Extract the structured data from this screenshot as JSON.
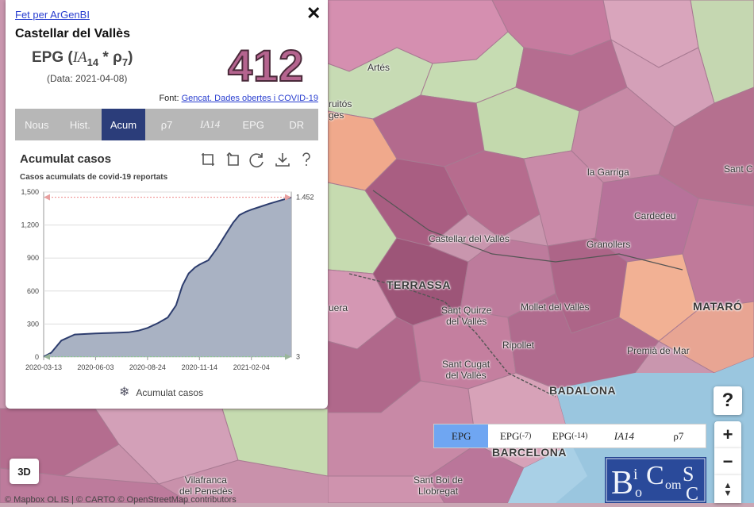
{
  "panel": {
    "link": "Fet per ArGenBI",
    "municipality": "Castellar del Vallès",
    "metric": {
      "prefix": "EPG (",
      "ia": "IA",
      "ia_sub": "14",
      "star": " * ",
      "rho": "ρ",
      "rho_sub": "7",
      "suffix": ")"
    },
    "date": "(Data: 2021-04-08)",
    "value": "412",
    "source_prefix": "Font: ",
    "source_link": "Gencat. Dades obertes i COVID-19",
    "tabs": [
      {
        "label": "Nous",
        "active": false
      },
      {
        "label": "Hist.",
        "active": false
      },
      {
        "label": "Acum",
        "active": true
      },
      {
        "label": "ρ7",
        "active": false
      },
      {
        "label": "IA14",
        "active": false
      },
      {
        "label": "EPG",
        "active": false
      },
      {
        "label": "DR",
        "active": false
      }
    ],
    "chart_title": "Acumulat casos",
    "chart_subtitle": "Casos acumulats de covid-19 reportats",
    "legend_label": "Acumulat casos",
    "icons": [
      "zoom-select-icon",
      "zoom-reset-icon",
      "restore-icon",
      "download-icon",
      "help-icon"
    ]
  },
  "chart_data": {
    "type": "area",
    "title": "Acumulat casos",
    "subtitle": "Casos acumulats de covid-19 reportats",
    "x_ticks": [
      "2020-03-13",
      "2020-06-03",
      "2020-08-24",
      "2020-11-14",
      "2021-02-04"
    ],
    "y_ticks": [
      "0",
      "300",
      "600",
      "900",
      "1,200",
      "1,500"
    ],
    "ylim": [
      0,
      1500
    ],
    "x_range": [
      "2020-03-13",
      "2021-04-08"
    ],
    "max_marker": "1.452",
    "min_marker": "3",
    "series": [
      {
        "name": "Acumulat casos",
        "x": [
          "2020-03-13",
          "2020-03-25",
          "2020-04-10",
          "2020-05-01",
          "2020-06-03",
          "2020-07-01",
          "2020-07-25",
          "2020-08-10",
          "2020-08-24",
          "2020-09-10",
          "2020-09-25",
          "2020-10-08",
          "2020-10-18",
          "2020-10-28",
          "2020-11-07",
          "2020-11-14",
          "2020-11-28",
          "2020-12-12",
          "2020-12-26",
          "2021-01-06",
          "2021-01-16",
          "2021-01-26",
          "2021-02-04",
          "2021-02-20",
          "2021-03-05",
          "2021-03-20",
          "2021-04-08"
        ],
        "values": [
          3,
          40,
          150,
          205,
          215,
          220,
          225,
          240,
          265,
          310,
          360,
          470,
          650,
          760,
          815,
          840,
          880,
          990,
          1120,
          1220,
          1290,
          1320,
          1340,
          1370,
          1395,
          1420,
          1452
        ]
      }
    ],
    "fill_color": "#a9b2c3",
    "line_color": "#2d3d6e"
  },
  "map": {
    "places": [
      {
        "id": "artes",
        "label": "Artés"
      },
      {
        "id": "la-garriga",
        "label": "la Garriga"
      },
      {
        "id": "sant-c",
        "label": "Sant C"
      },
      {
        "id": "cardedeu",
        "label": "Cardedeu"
      },
      {
        "id": "castellar",
        "label": "Castellar del Vallès"
      },
      {
        "id": "granollers",
        "label": "Granollers"
      },
      {
        "id": "terrassa",
        "label": "TERRASSA"
      },
      {
        "id": "sant-quirze",
        "label": "Sant Quirze\ndel Vallès"
      },
      {
        "id": "mollet",
        "label": "Mollet del Vallès"
      },
      {
        "id": "mataro",
        "label": "MATARÓ"
      },
      {
        "id": "ripollet",
        "label": "Ripollet"
      },
      {
        "id": "premia",
        "label": "Premià de Mar"
      },
      {
        "id": "sant-cugat",
        "label": "Sant Cugat\ndel Vallès"
      },
      {
        "id": "badalona",
        "label": "BADALONA"
      },
      {
        "id": "barcelona",
        "label": "BARCELONA"
      },
      {
        "id": "vilafranca",
        "label": "Vilafranca\ndel Penedès"
      },
      {
        "id": "sant-boi",
        "label": "Sant Boi de\nLlobregat"
      },
      {
        "id": "uera",
        "label": "uera"
      },
      {
        "id": "ruitos",
        "label": "ruitós\nges"
      }
    ],
    "chips": [
      {
        "label": "EPG",
        "sub": "",
        "active": true
      },
      {
        "label": "EPG",
        "sub": "(-7)",
        "active": false
      },
      {
        "label": "EPG",
        "sub": "(-14)",
        "active": false
      },
      {
        "label": "IA14",
        "sub": "",
        "active": false
      },
      {
        "label": "ρ7",
        "sub": "",
        "active": false
      }
    ],
    "controls": {
      "help": "?",
      "zoom_in": "+",
      "zoom_out": "−",
      "compass": "▲\n▼",
      "three_d": "3D"
    },
    "attribution": "© Mapbox  OL  IS  | © CARTO  © OpenStreetMap contributors",
    "logo_alt": "BioCom SC"
  }
}
